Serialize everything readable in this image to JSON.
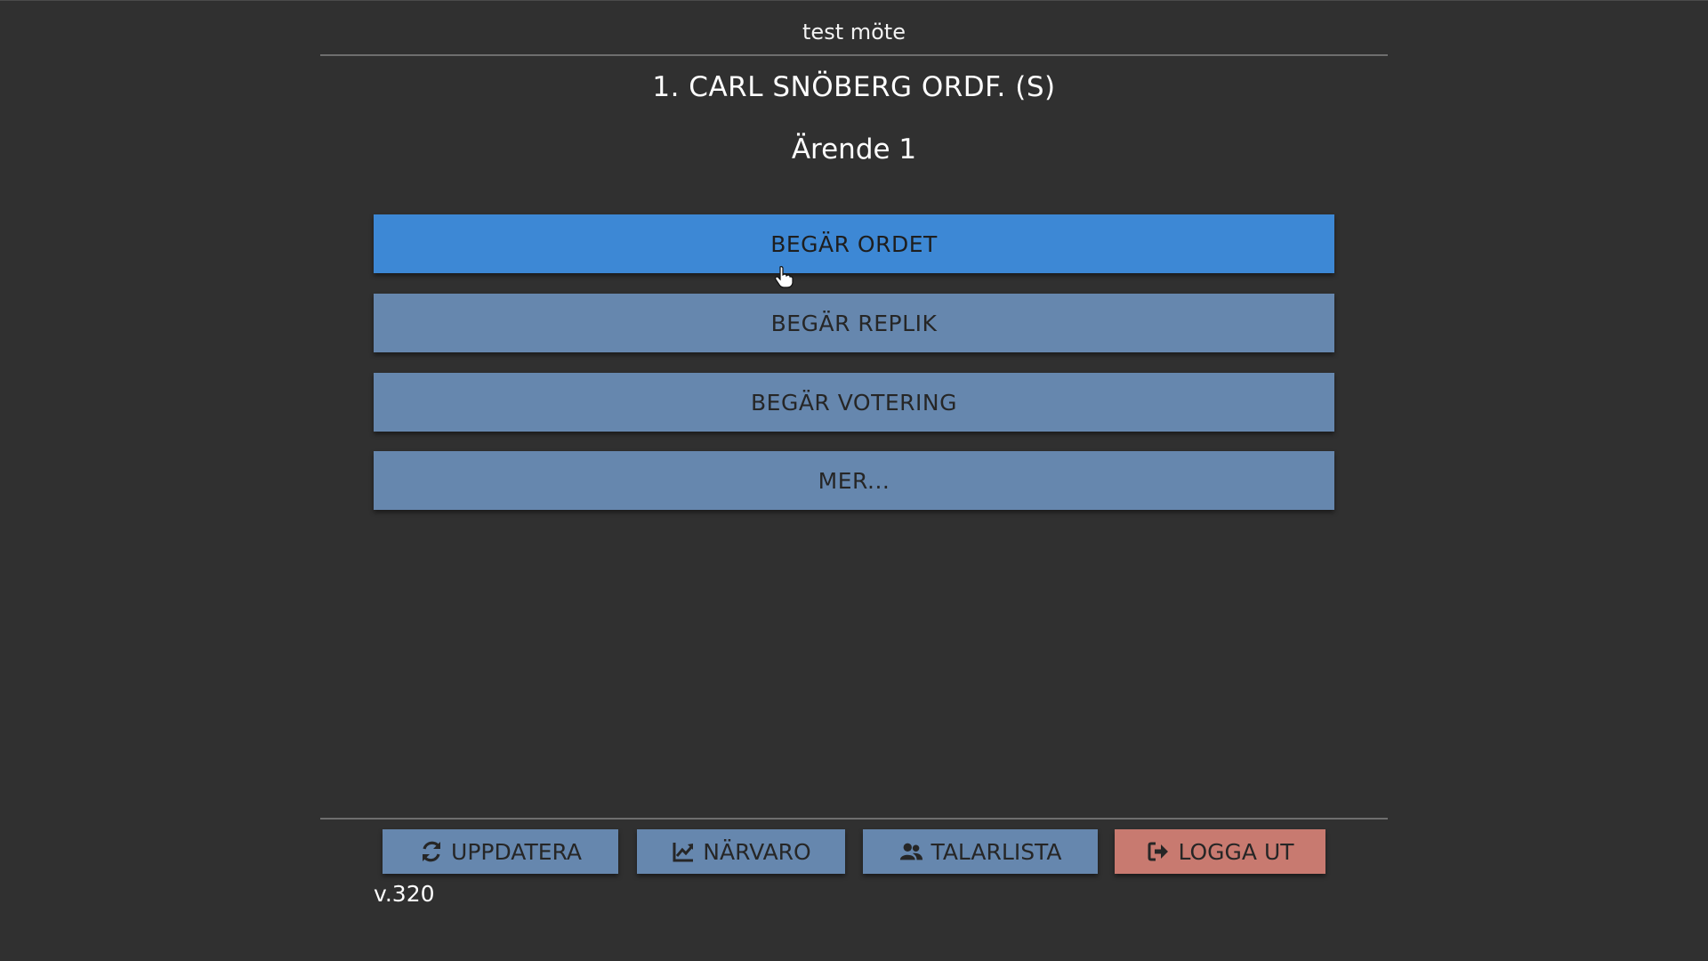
{
  "header": {
    "meeting_title": "test möte",
    "speaker_name": "1. CARL SNÖBERG ORDF. (S)",
    "agenda_item": "Ärende 1"
  },
  "actions": {
    "request_floor": "BEGÄR ORDET",
    "request_reply": "BEGÄR REPLIK",
    "request_vote": "BEGÄR VOTERING",
    "more": "MER..."
  },
  "footer": {
    "refresh": {
      "label": "UPPDATERA",
      "icon": "refresh-icon"
    },
    "attendance": {
      "label": "NÄRVARO",
      "icon": "chart-line-icon"
    },
    "speaker_list": {
      "label": "TALARLISTA",
      "icon": "users-icon"
    },
    "logout": {
      "label": "LOGGA UT",
      "icon": "sign-out-icon"
    },
    "version": "v.320"
  },
  "colors": {
    "background": "#303030",
    "primary_button": "#3d88d5",
    "secondary_button": "#6687ae",
    "danger_button": "#c87a70"
  }
}
